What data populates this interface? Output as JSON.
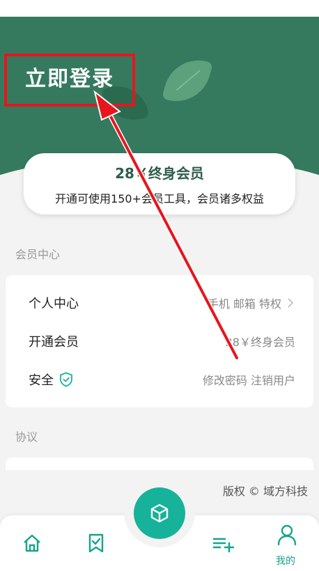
{
  "header": {
    "login_label": "立即登录"
  },
  "membership": {
    "title": "28￥终身会员",
    "subtitle": "开通可使用150+会员工具，会员诸多权益"
  },
  "sections": {
    "member_center": "会员中心",
    "agreement": "协议"
  },
  "member_list": [
    {
      "title": "个人中心",
      "detail": "手机 邮箱 特权"
    },
    {
      "title": "开通会员",
      "detail": "28￥终身会员"
    },
    {
      "title": "安全",
      "detail": "修改密码  注销用户"
    }
  ],
  "footer": {
    "copyright": "版权 © 域方科技"
  },
  "nav": {
    "me_label": "我的"
  },
  "colors": {
    "brand_green": "#357a5f",
    "accent_teal": "#16b39a",
    "annotation_red": "#e8151c"
  },
  "icons": [
    "home-icon",
    "bookmark-check-icon",
    "cube-icon",
    "playlist-add-icon",
    "user-icon",
    "shield-check-icon",
    "chevron-right-icon"
  ]
}
